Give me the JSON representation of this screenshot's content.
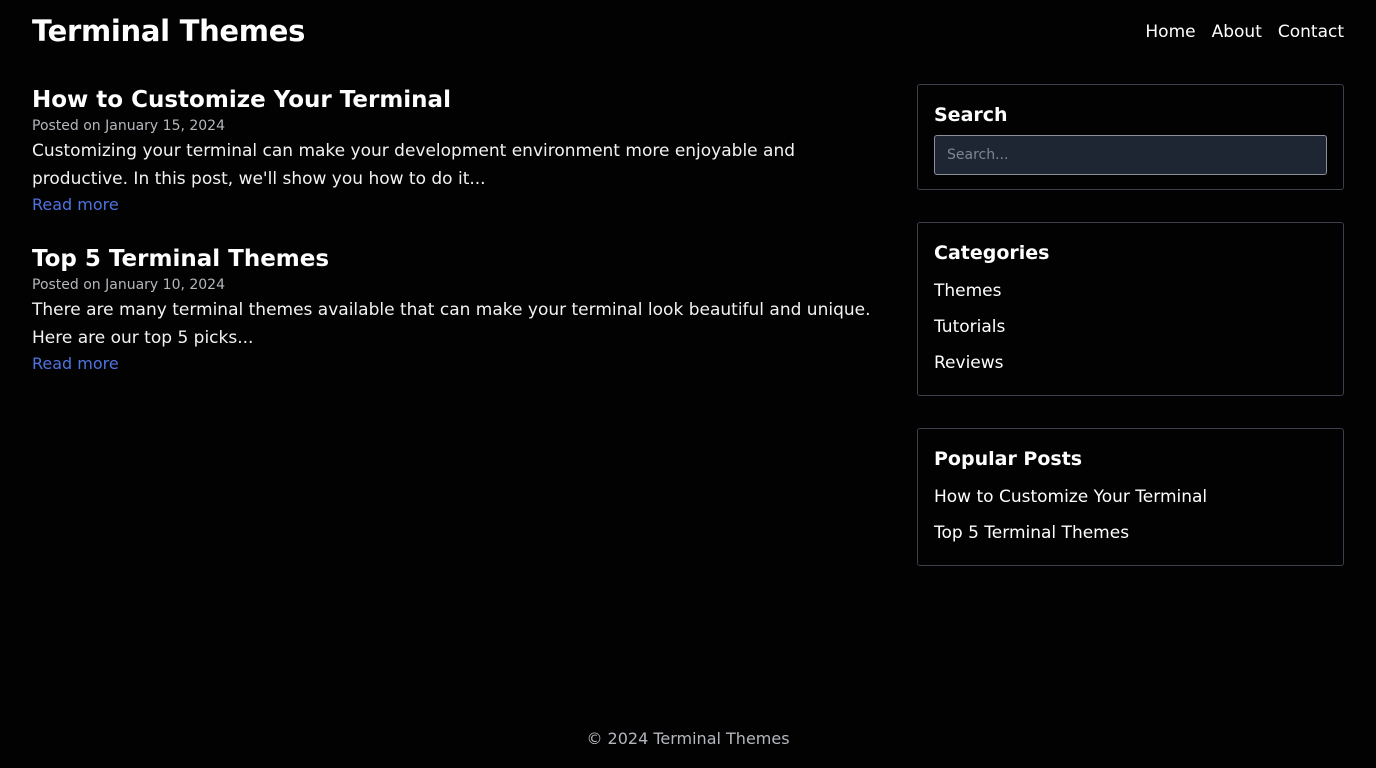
{
  "header": {
    "site_title": "Terminal Themes",
    "nav": [
      {
        "label": "Home"
      },
      {
        "label": "About"
      },
      {
        "label": "Contact"
      }
    ]
  },
  "posts": [
    {
      "title": "How to Customize Your Terminal",
      "meta": "Posted on January 15, 2024",
      "excerpt": "Customizing your terminal can make your development environment more enjoyable and productive. In this post, we'll show you how to do it...",
      "read_more": "Read more"
    },
    {
      "title": "Top 5 Terminal Themes",
      "meta": "Posted on January 10, 2024",
      "excerpt": "There are many terminal themes available that can make your terminal look beautiful and unique. Here are our top 5 picks...",
      "read_more": "Read more"
    }
  ],
  "sidebar": {
    "search": {
      "title": "Search",
      "placeholder": "Search..."
    },
    "categories": {
      "title": "Categories",
      "items": [
        {
          "label": "Themes"
        },
        {
          "label": "Tutorials"
        },
        {
          "label": "Reviews"
        }
      ]
    },
    "popular": {
      "title": "Popular Posts",
      "items": [
        {
          "label": "How to Customize Your Terminal"
        },
        {
          "label": "Top 5 Terminal Themes"
        }
      ]
    }
  },
  "footer": {
    "text": "© 2024 Terminal Themes"
  },
  "colors": {
    "background": "#020202",
    "link": "#4f73e0",
    "muted": "#b4b7bd",
    "border": "#3a3f4b",
    "input_bg": "#1f2633"
  }
}
